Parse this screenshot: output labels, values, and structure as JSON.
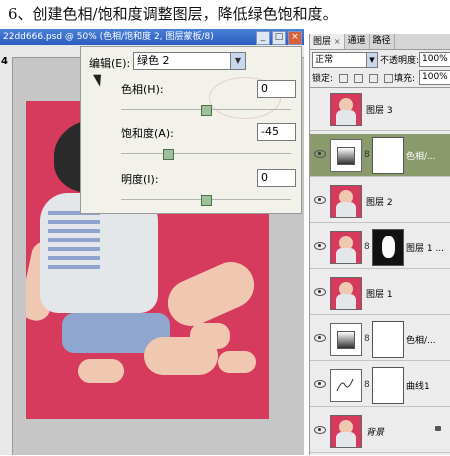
{
  "heading": "6、创建色相/饱和度调整图层，降低绿色饱和度。",
  "doc_window": {
    "title": "22dd666.psd @ 50% (色相/饱和度 2, 图层蒙板/8)",
    "ruler_mark": "4",
    "buttons": {
      "minimize": "_",
      "maximize": "□",
      "close": "×"
    }
  },
  "dialog": {
    "edit_label": "编辑(E):",
    "edit_value": "绿色 2",
    "hue_label": "色相(H):",
    "hue_value": "0",
    "hue_level": 0,
    "saturation_label": "饱和度(A):",
    "saturation_value": "-45",
    "saturation_level": -45,
    "lightness_label": "明度(I):",
    "lightness_value": "0",
    "lightness_level": 0
  },
  "layers_panel": {
    "tabs": [
      "图层",
      "通道",
      "路径"
    ],
    "blend_mode": "正常",
    "opacity_label": "不透明度:",
    "opacity_value": "100%",
    "lock_label": "锁定:",
    "fill_label": "填充:",
    "fill_value": "100%",
    "layers": [
      {
        "name": "图层 3",
        "kind": "photo",
        "visible": false,
        "selected": false
      },
      {
        "name": "色相/...",
        "kind": "adjustment-mask-white",
        "visible": true,
        "selected": true
      },
      {
        "name": "图层 2",
        "kind": "photo",
        "visible": true,
        "selected": false
      },
      {
        "name": "图层 1 ...",
        "kind": "photo-mask-black",
        "visible": true,
        "selected": false
      },
      {
        "name": "图层 1",
        "kind": "photo",
        "visible": true,
        "selected": false
      },
      {
        "name": "色相/...",
        "kind": "adjustment-mask-white",
        "visible": true,
        "selected": false
      },
      {
        "name": "曲线1",
        "kind": "curves-mask-white",
        "visible": true,
        "selected": false
      },
      {
        "name": "背景",
        "kind": "background",
        "visible": true,
        "selected": false
      }
    ]
  },
  "colors": {
    "photo_bg": "#d63a5c",
    "selected_layer": "#8b9a6d",
    "title_bar": "#2c5cbf"
  }
}
